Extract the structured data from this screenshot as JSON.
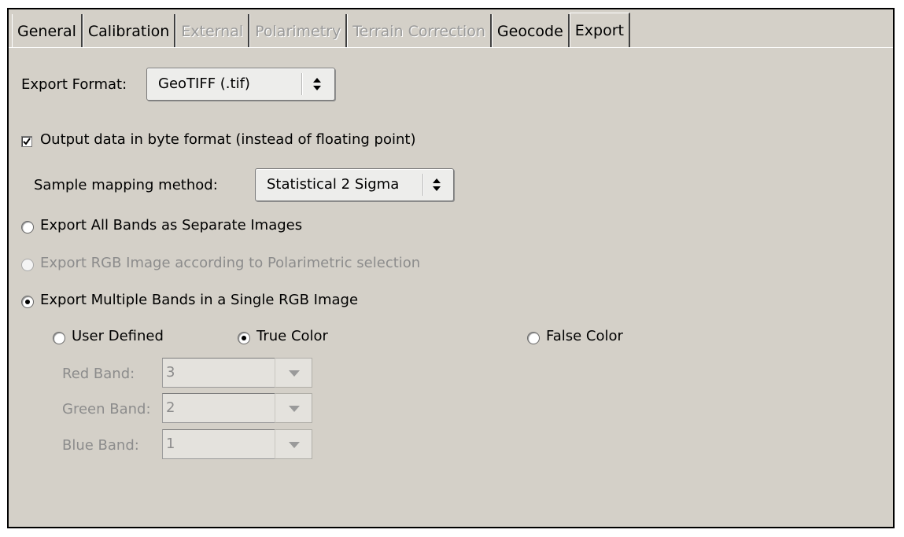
{
  "tabs": [
    {
      "label": "General",
      "state": "normal"
    },
    {
      "label": "Calibration",
      "state": "normal"
    },
    {
      "label": "External",
      "state": "disabled"
    },
    {
      "label": "Polarimetry",
      "state": "disabled"
    },
    {
      "label": "Terrain Correction",
      "state": "disabled"
    },
    {
      "label": "Geocode",
      "state": "normal"
    },
    {
      "label": "Export",
      "state": "active"
    }
  ],
  "export_format": {
    "label": "Export Format:",
    "value": "GeoTIFF (.tif)"
  },
  "byte_format": {
    "label": "Output data in byte format (instead of floating point)",
    "checked": true
  },
  "sample_mapping": {
    "label": "Sample mapping method:",
    "value": "Statistical 2 Sigma"
  },
  "export_options": [
    {
      "label": "Export All Bands as Separate Images",
      "selected": false,
      "enabled": true
    },
    {
      "label": "Export RGB Image according to Polarimetric selection",
      "selected": false,
      "enabled": false
    },
    {
      "label": "Export Multiple Bands in a Single RGB Image",
      "selected": true,
      "enabled": true
    }
  ],
  "color_options": [
    {
      "label": "User Defined",
      "selected": false
    },
    {
      "label": "True Color",
      "selected": true
    },
    {
      "label": "False Color",
      "selected": false
    }
  ],
  "bands": [
    {
      "label": "Red Band:",
      "value": "3"
    },
    {
      "label": "Green Band:",
      "value": "2"
    },
    {
      "label": "Blue Band:",
      "value": "1"
    }
  ],
  "colors": {
    "panel_bg": "#d4d0c8",
    "disabled_text": "#8c8c8c"
  }
}
